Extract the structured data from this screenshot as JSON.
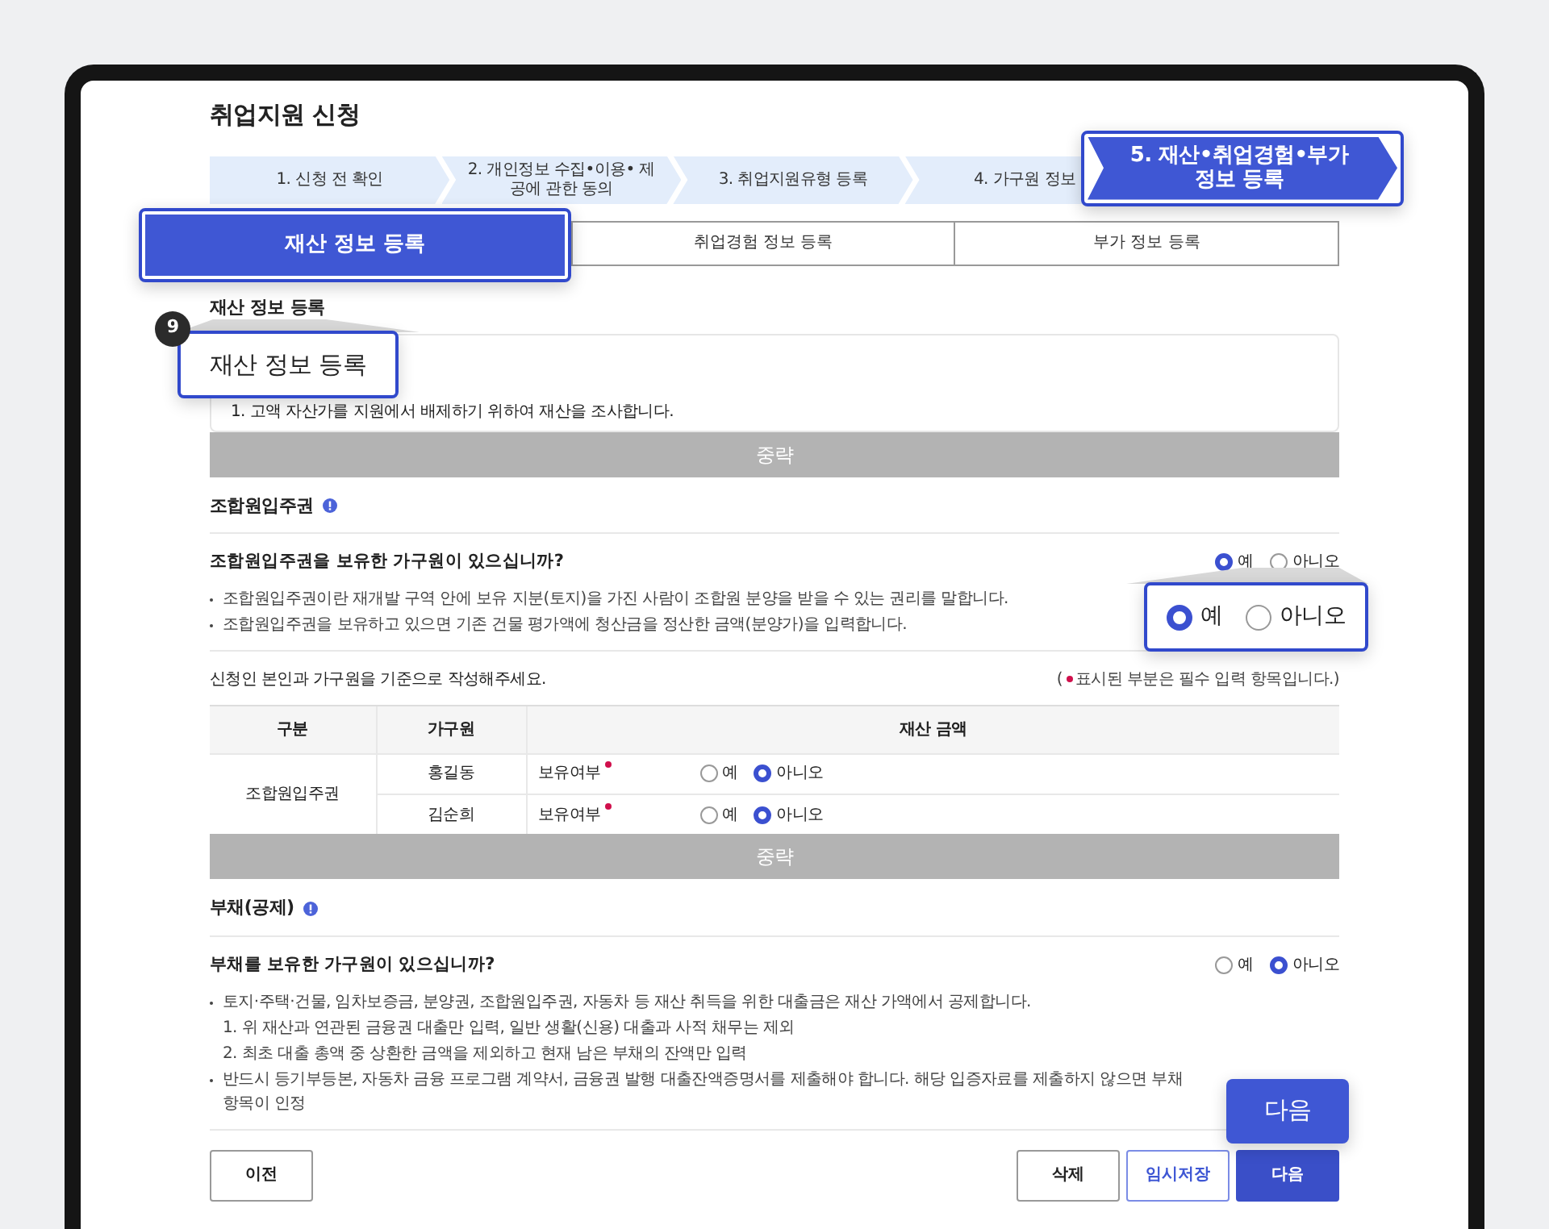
{
  "page_title": "취업지원 신청",
  "steps": [
    {
      "label": "1. 신청 전 확인",
      "selected": false
    },
    {
      "label": "2. 개인정보 수집•이용• 제공에 관한 동의",
      "selected": false
    },
    {
      "label": "3. 취업지원유형 등록",
      "selected": false
    },
    {
      "label": "4. 가구원 정보",
      "selected": false
    },
    {
      "label": "5. 재산•취업경험•부가 정보 등록",
      "selected": true
    }
  ],
  "sub_tabs": [
    {
      "label": "재산 정보 등록",
      "selected": true
    },
    {
      "label": "취업경험 정보 등록",
      "selected": false
    },
    {
      "label": "부가 정보 등록",
      "selected": false
    }
  ],
  "section": {
    "title": "재산 정보 등록",
    "callout_badge": "9",
    "callout_text": "재산 정보 등록"
  },
  "intro_notes": [
    "1. 고액 자산가를 지원에서 배제하기 위하여 재산을 조사합니다."
  ],
  "omission_bars": [
    "중략",
    "중략"
  ],
  "union_rights": {
    "title": "조합원입주권",
    "question": "조합원입주권을 보유한 가구원이 있으십니까?",
    "options": [
      {
        "label": "예",
        "selected": true
      },
      {
        "label": "아니오",
        "selected": false
      }
    ],
    "callout_options": [
      {
        "label": "예",
        "selected": true
      },
      {
        "label": "아니오",
        "selected": false
      }
    ],
    "notes": [
      {
        "kind": "bullet",
        "text": "조합원입주권이란 재개발 구역 안에 보유 지분(토지)을 가진 사람이 조합원 분양을 받을 수 있는 권리를 말합니다."
      },
      {
        "kind": "bullet",
        "text": "조합원입주권을 보유하고 있으면 기존 건물 평가액에 청산금을 정산한 금액(분양가)을 입력합니다."
      }
    ]
  },
  "table_intro": "신청인 본인과 가구원을 기준으로 작성해주세요.",
  "required_note_open": "(",
  "required_note": "표시된 부분은 필수 입력 항목입니다.)",
  "table": {
    "columns": [
      "구분",
      "가구원",
      "재산 금액"
    ],
    "group": "조합원입주권",
    "rows": [
      {
        "member": "홍길동",
        "field": "보유여부",
        "required": true,
        "options": [
          {
            "label": "예",
            "selected": false
          },
          {
            "label": "아니오",
            "selected": true
          }
        ]
      },
      {
        "member": "김순희",
        "field": "보유여부",
        "required": true,
        "options": [
          {
            "label": "예",
            "selected": false
          },
          {
            "label": "아니오",
            "selected": true
          }
        ]
      }
    ]
  },
  "debt": {
    "title": "부채(공제)",
    "question": "부채를 보유한 가구원이 있으십니까?",
    "options": [
      {
        "label": "예",
        "selected": false
      },
      {
        "label": "아니오",
        "selected": true
      }
    ],
    "notes": [
      {
        "kind": "bullet",
        "text": "토지·주택·건물, 임차보증금, 분양권, 조합원입주권, 자동차 등 재산 취득을 위한 대출금은 재산 가액에서 공제합니다."
      },
      {
        "kind": "sub",
        "text": "1. 위 재산과 연관된 금융권 대출만 입력, 일반 생활(신용) 대출과 사적 채무는 제외"
      },
      {
        "kind": "sub",
        "text": "2. 최초 대출 총액 중 상환한 금액을 제외하고 현재 남은 부채의 잔액만 입력"
      },
      {
        "kind": "bullet",
        "text": "반드시 등기부등본, 자동차 금융 프로그램 계약서, 금융권 발행 대출잔액증명서를 제출해야 합니다. 해당 입증자료를 제출하지 않으면 부채 항목이 인정"
      }
    ]
  },
  "buttons": [
    {
      "label": "이전",
      "kind": "outline"
    },
    {
      "label": "삭제",
      "kind": "outline"
    },
    {
      "label": "임시저장",
      "kind": "primary-outline"
    },
    {
      "label": "다음",
      "kind": "primary"
    }
  ],
  "next_callout": "다음"
}
